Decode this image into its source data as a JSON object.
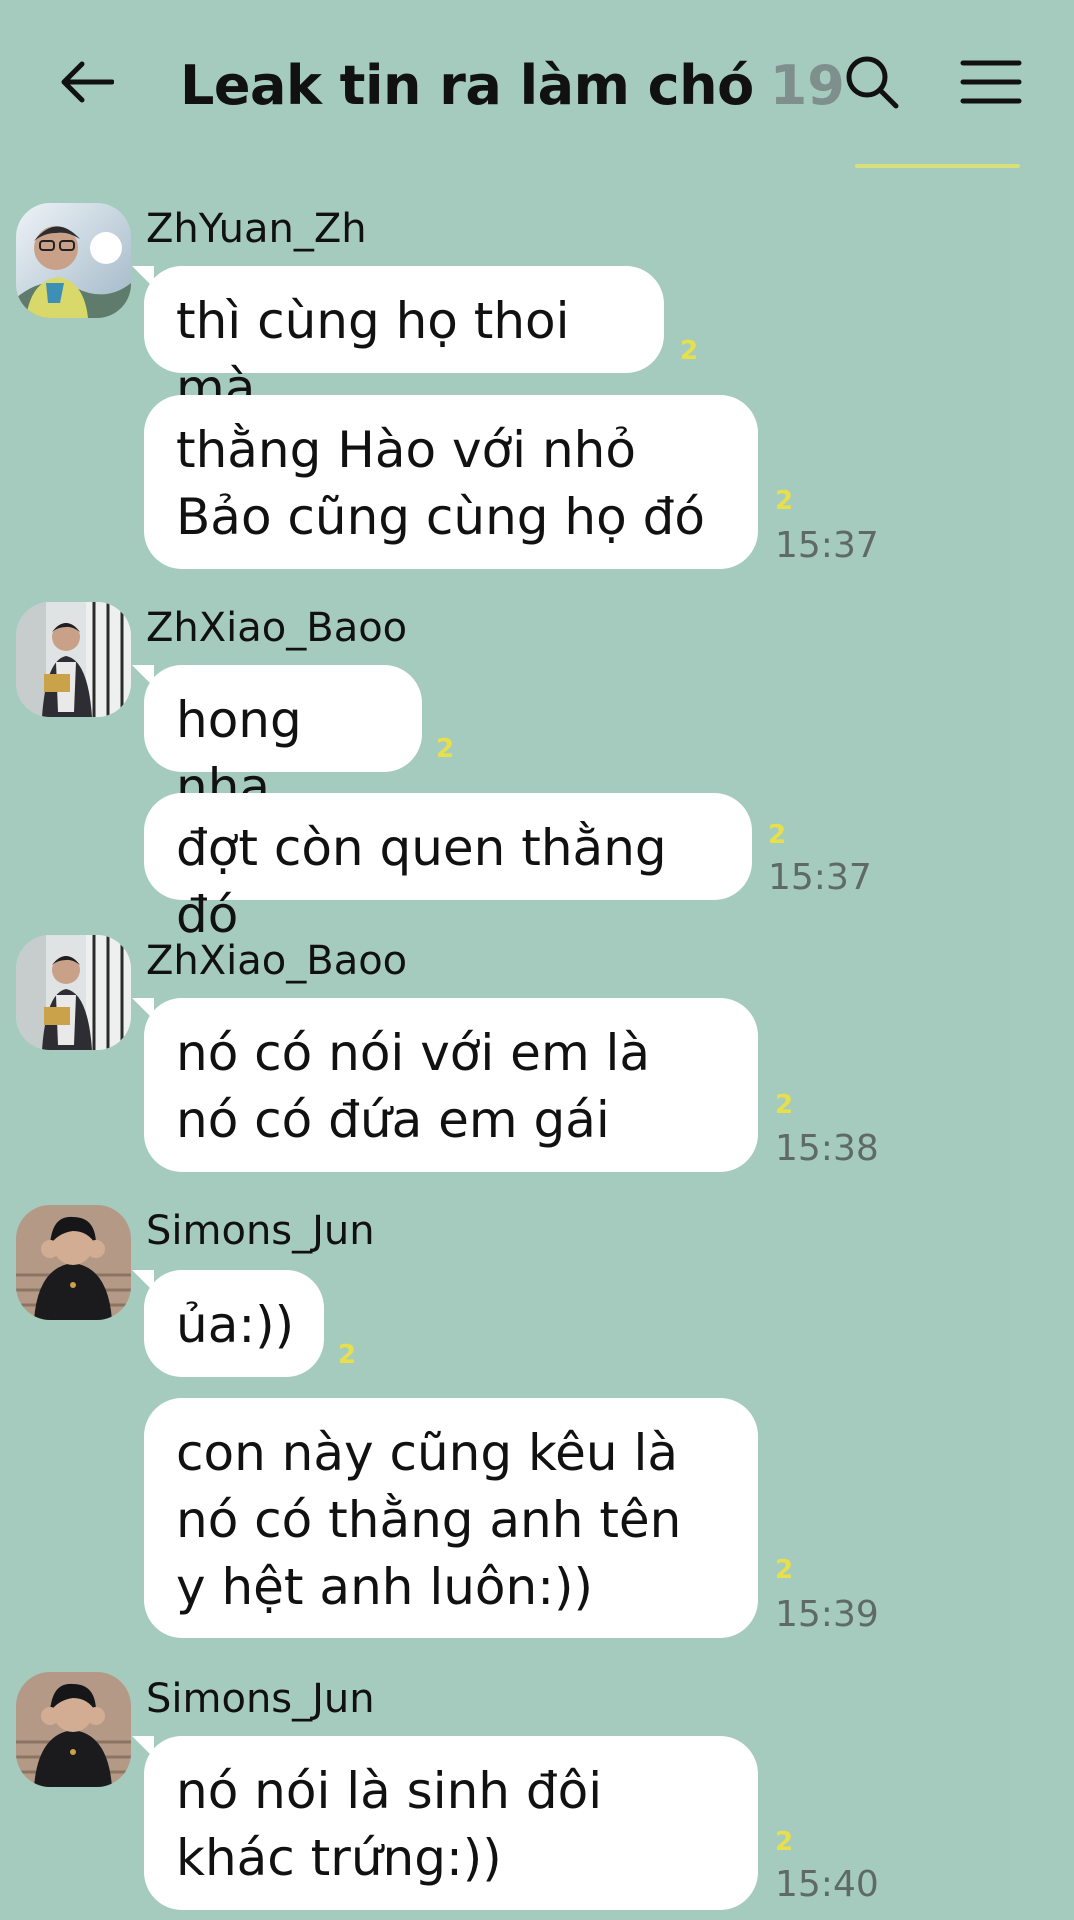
{
  "header": {
    "title": "Leak tin ra làm chó",
    "member_count": "19",
    "back_icon": "arrow-left-icon",
    "search_icon": "search-icon",
    "menu_icon": "hamburger-menu-icon"
  },
  "messages": [
    {
      "sender": "ZhYuan_Zh",
      "bubbles": [
        {
          "text": "thì cùng họ thoi mà",
          "unread": "2",
          "time": ""
        },
        {
          "text": "thằng Hào với nhỏ Bảo cũng cùng họ đó",
          "unread": "2",
          "time": "15:37"
        }
      ]
    },
    {
      "sender": "ZhXiao_Baoo",
      "bubbles": [
        {
          "text": "hong nha",
          "unread": "2",
          "time": ""
        },
        {
          "text": "đợt còn quen thằng đó",
          "unread": "2",
          "time": "15:37"
        }
      ]
    },
    {
      "sender": "ZhXiao_Baoo",
      "bubbles": [
        {
          "text": "nó có nói với em là nó có đứa em gái",
          "unread": "2",
          "time": "15:38"
        }
      ]
    },
    {
      "sender": "Simons_Jun",
      "bubbles": [
        {
          "text": "ủa:))",
          "unread": "2",
          "time": ""
        },
        {
          "text": "con này cũng kêu là nó có thằng anh tên y hệt anh luôn:))",
          "unread": "2",
          "time": "15:39"
        }
      ]
    },
    {
      "sender": "Simons_Jun",
      "bubbles": [
        {
          "text": "nó nói là sinh đôi khác trứng:))",
          "unread": "2",
          "time": "15:40"
        }
      ]
    }
  ]
}
